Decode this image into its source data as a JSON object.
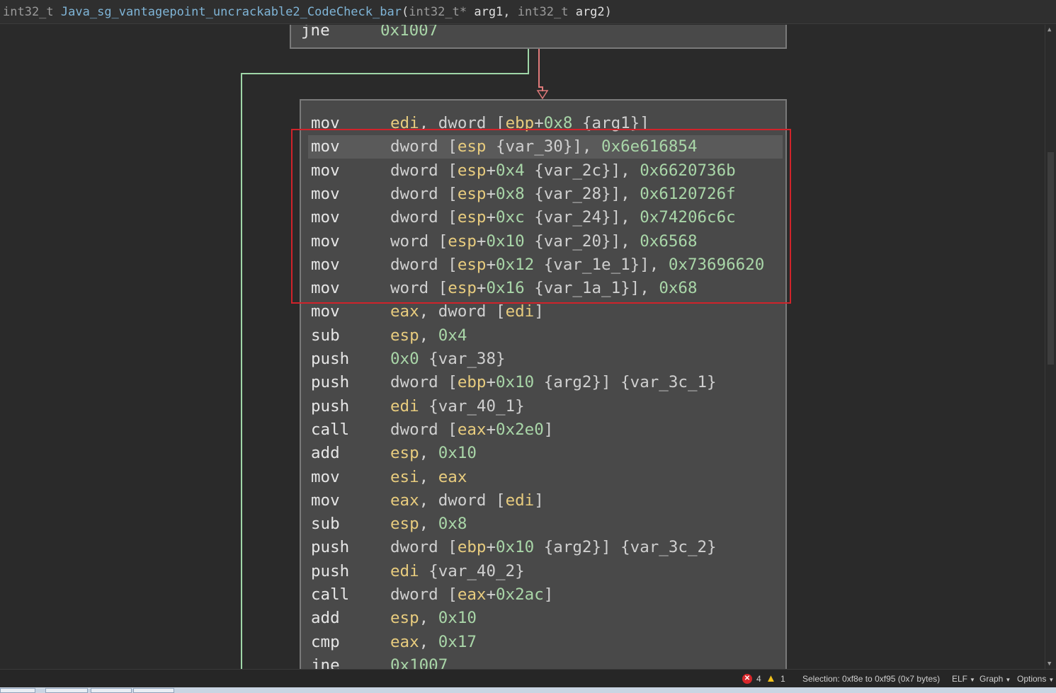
{
  "header": {
    "return_type": "int32_t",
    "function_name": "Java_sg_vantagepoint_uncrackable2_CodeCheck_bar",
    "open_paren": "(",
    "param1_type": "int32_t*",
    "param1_name": "arg1",
    "comma": ",",
    "param2_type": "int32_t",
    "param2_name": "arg2",
    "close_paren": ")"
  },
  "prev_block": {
    "mnemonic": "jne",
    "operand": "0x1007"
  },
  "instructions": [
    {
      "mn": "mov",
      "parts": [
        [
          "reg",
          "edi"
        ],
        [
          "pu",
          ", "
        ],
        [
          "pu",
          "dword ["
        ],
        [
          "reg",
          "ebp"
        ],
        [
          "pu",
          "+"
        ],
        [
          "num",
          "0x8"
        ],
        [
          "pu",
          " "
        ],
        [
          "var",
          "{arg1}"
        ],
        [
          "pu",
          "]"
        ]
      ]
    },
    {
      "mn": "mov",
      "parts": [
        [
          "pu",
          "dword ["
        ],
        [
          "reg",
          "esp"
        ],
        [
          "pu",
          " "
        ],
        [
          "var",
          "{var_30}"
        ],
        [
          "pu",
          "], "
        ],
        [
          "num",
          "0x6e616854"
        ]
      ]
    },
    {
      "mn": "mov",
      "parts": [
        [
          "pu",
          "dword ["
        ],
        [
          "reg",
          "esp"
        ],
        [
          "pu",
          "+"
        ],
        [
          "num",
          "0x4"
        ],
        [
          "pu",
          " "
        ],
        [
          "var",
          "{var_2c}"
        ],
        [
          "pu",
          "], "
        ],
        [
          "num",
          "0x6620736b"
        ]
      ]
    },
    {
      "mn": "mov",
      "parts": [
        [
          "pu",
          "dword ["
        ],
        [
          "reg",
          "esp"
        ],
        [
          "pu",
          "+"
        ],
        [
          "num",
          "0x8"
        ],
        [
          "pu",
          " "
        ],
        [
          "var",
          "{var_28}"
        ],
        [
          "pu",
          "], "
        ],
        [
          "num",
          "0x6120726f"
        ]
      ]
    },
    {
      "mn": "mov",
      "parts": [
        [
          "pu",
          "dword ["
        ],
        [
          "reg",
          "esp"
        ],
        [
          "pu",
          "+"
        ],
        [
          "num",
          "0xc"
        ],
        [
          "pu",
          " "
        ],
        [
          "var",
          "{var_24}"
        ],
        [
          "pu",
          "], "
        ],
        [
          "num",
          "0x74206c6c"
        ]
      ]
    },
    {
      "mn": "mov",
      "parts": [
        [
          "pu",
          "word ["
        ],
        [
          "reg",
          "esp"
        ],
        [
          "pu",
          "+"
        ],
        [
          "num",
          "0x10"
        ],
        [
          "pu",
          " "
        ],
        [
          "var",
          "{var_20}"
        ],
        [
          "pu",
          "], "
        ],
        [
          "num",
          "0x6568"
        ]
      ]
    },
    {
      "mn": "mov",
      "parts": [
        [
          "pu",
          "dword ["
        ],
        [
          "reg",
          "esp"
        ],
        [
          "pu",
          "+"
        ],
        [
          "num",
          "0x12"
        ],
        [
          "pu",
          " "
        ],
        [
          "var",
          "{var_1e_1}"
        ],
        [
          "pu",
          "], "
        ],
        [
          "num",
          "0x73696620"
        ]
      ]
    },
    {
      "mn": "mov",
      "parts": [
        [
          "pu",
          "word ["
        ],
        [
          "reg",
          "esp"
        ],
        [
          "pu",
          "+"
        ],
        [
          "num",
          "0x16"
        ],
        [
          "pu",
          " "
        ],
        [
          "var",
          "{var_1a_1}"
        ],
        [
          "pu",
          "], "
        ],
        [
          "num",
          "0x68"
        ]
      ]
    },
    {
      "mn": "mov",
      "parts": [
        [
          "reg",
          "eax"
        ],
        [
          "pu",
          ", dword ["
        ],
        [
          "reg",
          "edi"
        ],
        [
          "pu",
          "]"
        ]
      ]
    },
    {
      "mn": "sub",
      "parts": [
        [
          "reg",
          "esp"
        ],
        [
          "pu",
          ", "
        ],
        [
          "num",
          "0x4"
        ]
      ]
    },
    {
      "mn": "push",
      "parts": [
        [
          "num",
          "0x0"
        ],
        [
          "pu",
          " "
        ],
        [
          "var",
          "{var_38}"
        ]
      ]
    },
    {
      "mn": "push",
      "parts": [
        [
          "pu",
          "dword ["
        ],
        [
          "reg",
          "ebp"
        ],
        [
          "pu",
          "+"
        ],
        [
          "num",
          "0x10"
        ],
        [
          "pu",
          " "
        ],
        [
          "var",
          "{arg2}"
        ],
        [
          "pu",
          "] "
        ],
        [
          "var",
          "{var_3c_1}"
        ]
      ]
    },
    {
      "mn": "push",
      "parts": [
        [
          "reg",
          "edi"
        ],
        [
          "pu",
          " "
        ],
        [
          "var",
          "{var_40_1}"
        ]
      ]
    },
    {
      "mn": "call",
      "parts": [
        [
          "pu",
          "dword ["
        ],
        [
          "reg",
          "eax"
        ],
        [
          "pu",
          "+"
        ],
        [
          "num",
          "0x2e0"
        ],
        [
          "pu",
          "]"
        ]
      ]
    },
    {
      "mn": "add",
      "parts": [
        [
          "reg",
          "esp"
        ],
        [
          "pu",
          ", "
        ],
        [
          "num",
          "0x10"
        ]
      ]
    },
    {
      "mn": "mov",
      "parts": [
        [
          "reg",
          "esi"
        ],
        [
          "pu",
          ", "
        ],
        [
          "reg",
          "eax"
        ]
      ]
    },
    {
      "mn": "mov",
      "parts": [
        [
          "reg",
          "eax"
        ],
        [
          "pu",
          ", dword ["
        ],
        [
          "reg",
          "edi"
        ],
        [
          "pu",
          "]"
        ]
      ]
    },
    {
      "mn": "sub",
      "parts": [
        [
          "reg",
          "esp"
        ],
        [
          "pu",
          ", "
        ],
        [
          "num",
          "0x8"
        ]
      ]
    },
    {
      "mn": "push",
      "parts": [
        [
          "pu",
          "dword ["
        ],
        [
          "reg",
          "ebp"
        ],
        [
          "pu",
          "+"
        ],
        [
          "num",
          "0x10"
        ],
        [
          "pu",
          " "
        ],
        [
          "var",
          "{arg2}"
        ],
        [
          "pu",
          "] "
        ],
        [
          "var",
          "{var_3c_2}"
        ]
      ]
    },
    {
      "mn": "push",
      "parts": [
        [
          "reg",
          "edi"
        ],
        [
          "pu",
          " "
        ],
        [
          "var",
          "{var_40_2}"
        ]
      ]
    },
    {
      "mn": "call",
      "parts": [
        [
          "pu",
          "dword ["
        ],
        [
          "reg",
          "eax"
        ],
        [
          "pu",
          "+"
        ],
        [
          "num",
          "0x2ac"
        ],
        [
          "pu",
          "]"
        ]
      ]
    },
    {
      "mn": "add",
      "parts": [
        [
          "reg",
          "esp"
        ],
        [
          "pu",
          ", "
        ],
        [
          "num",
          "0x10"
        ]
      ]
    },
    {
      "mn": "cmp",
      "parts": [
        [
          "reg",
          "eax"
        ],
        [
          "pu",
          ", "
        ],
        [
          "num",
          "0x17"
        ]
      ]
    },
    {
      "mn": "jne",
      "parts": [
        [
          "num",
          "0x1007"
        ]
      ]
    }
  ],
  "status": {
    "error_count": "4",
    "warning_count": "1",
    "selection": "Selection: 0xf8e to 0xf95 (0x7 bytes)",
    "menu_elf": "ELF",
    "menu_graph": "Graph",
    "menu_options": "Options"
  },
  "colors": {
    "true_edge": "#9fd6a8",
    "false_edge": "#e07a7a",
    "highlight_box": "#d0232a"
  }
}
